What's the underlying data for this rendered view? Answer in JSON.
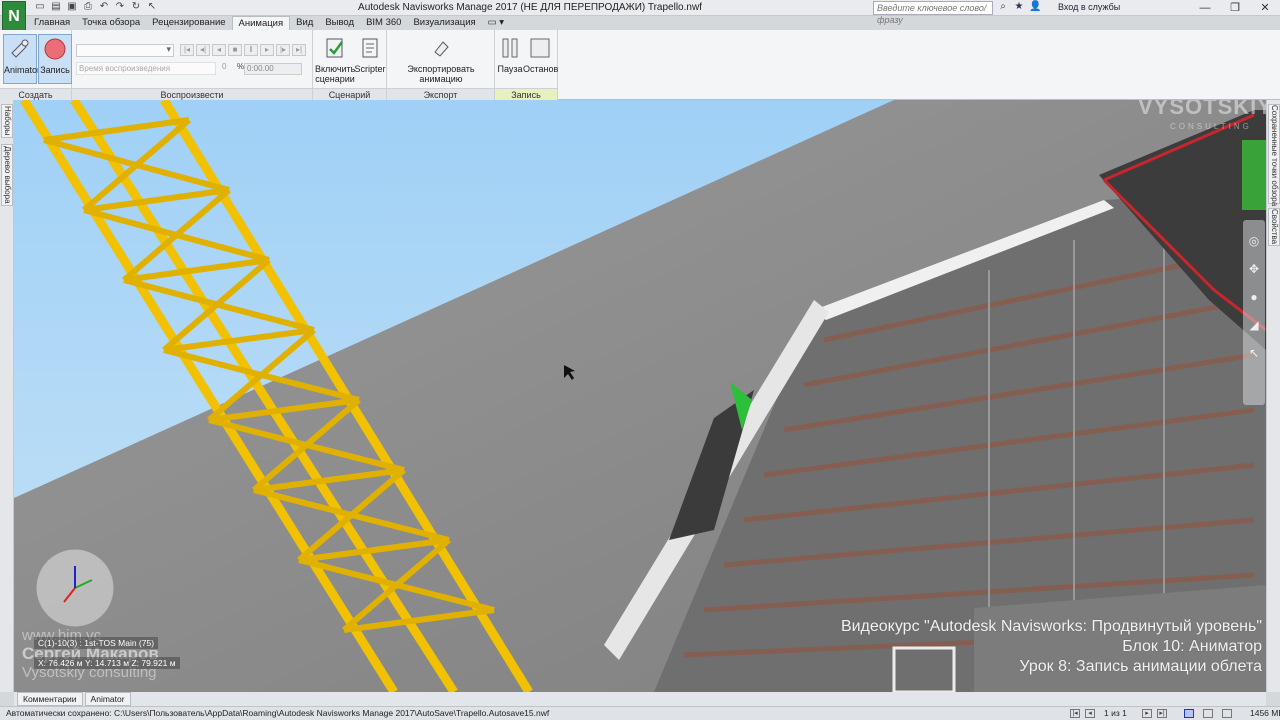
{
  "titlebar": {
    "app_letter": "N",
    "title": "Autodesk Navisworks Manage 2017 (НЕ ДЛЯ ПЕРЕПРОДАЖИ)    Trapello.nwf",
    "search_placeholder": "Введите ключевое слово/фразу",
    "login": "Вход в службы",
    "minimize": "—",
    "restore": "❐",
    "close": "✕"
  },
  "tabs": [
    "Главная",
    "Точка обзора",
    "Рецензирование",
    "Анимация",
    "Вид",
    "Вывод",
    "BIM 360",
    "Визуализация"
  ],
  "active_tab": "Анимация",
  "ribbon": {
    "create": {
      "label": "Создать",
      "animator": "Animator",
      "record": "Запись"
    },
    "playback": {
      "label": "Воспроизвести",
      "time_label": "Время воспроизведения",
      "value_zero": "0",
      "percent": "%",
      "time_value": "0:00.00"
    },
    "scripts": {
      "label": "Сценарий",
      "enable": "Включить сценарии",
      "scripter": "Scripter"
    },
    "export": {
      "label": "Экспорт",
      "export_anim": "Экспортировать анимацию"
    },
    "recording": {
      "label": "Запись",
      "pause": "Пауза",
      "stop": "Останов"
    }
  },
  "left_dock_tabs": [
    "Наборы",
    "Дерево выбора"
  ],
  "right_dock_tabs": [
    "Сохраненные точки обзора",
    "Свойства"
  ],
  "viewport": {
    "course_line1": "Видеокурс \"Autodesk Navisworks: Продвинутый уровень\"",
    "course_line2": "Блок 10: Аниматор",
    "course_line3": "Урок 8: Запись анимации облета",
    "site": "www.bim.vc",
    "author": "Сергей Макаров",
    "company": "Vysotskiy consulting",
    "brand": "VYSOTSKIY",
    "brand_sub": "CONSULTING",
    "grid_label": "C(1)-10(3) : 1st-TOS Main (75)",
    "coords": "X: 76.426 м  Y: 14.713 м  Z: 79.921 м"
  },
  "bottom_tabs": [
    "Комментарии",
    "Animator"
  ],
  "status": {
    "autosave": "Автоматически сохранено: C:\\Users\\Пользователь\\AppData\\Roaming\\Autodesk Navisworks Manage 2017\\AutoSave\\Trapello.Autosave15.nwf",
    "pages": "1 из 1",
    "memory": "1456 МБ"
  },
  "colors": {
    "crane_yellow": "#f2c200",
    "sky": "#a8d3f4",
    "wall_gray": "#8c8c8c",
    "roof_red": "#c8262d",
    "cone_green": "#2bbf3a"
  }
}
